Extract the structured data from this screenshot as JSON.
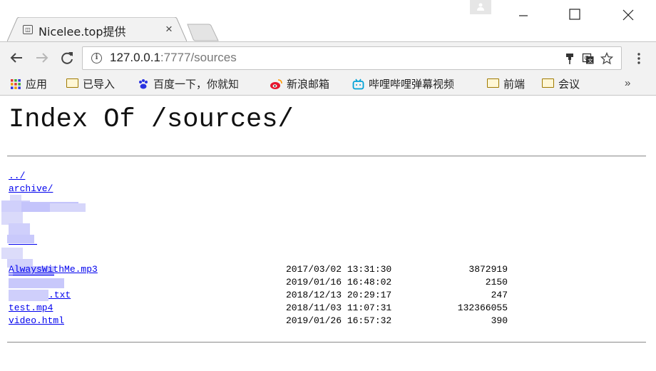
{
  "tab": {
    "title": "Nicelee.top提供",
    "close": "×"
  },
  "omnibox": {
    "host": "127.0.0.1",
    "path": ":7777/sources"
  },
  "bookmarks": [
    {
      "label": "应用",
      "icon": "apps-grid-icon"
    },
    {
      "label": "已导入",
      "icon": "folder-icon"
    },
    {
      "label": "百度一下，你就知",
      "icon": "baidu-paw-icon"
    },
    {
      "label": "新浪邮箱",
      "icon": "weibo-icon"
    },
    {
      "label": "哔哩哔哩弹幕视频",
      "icon": "bilibili-tv-icon"
    },
    {
      "label": "前端",
      "icon": "folder-icon"
    },
    {
      "label": "会议",
      "icon": "folder-icon"
    }
  ],
  "bookmarks_more": "»",
  "page": {
    "heading": "Index Of /sources/",
    "entries": [
      {
        "name": "../",
        "date": "",
        "size": ""
      },
      {
        "name": "archive/",
        "date": "",
        "size": ""
      },
      {
        "name": "AlwaysWithMe.mp3",
        "date": "2017/03/02  13:31:30",
        "size": "3872919"
      },
      {
        "name": "",
        "date": "2019/01/16  16:48:02",
        "size": "2150"
      },
      {
        "name": ".txt",
        "date": "2018/12/13  20:29:17",
        "size": "247"
      },
      {
        "name": "test.mp4",
        "date": "2018/11/03  11:07:31",
        "size": "132366055"
      },
      {
        "name": "video.html",
        "date": "2019/01/26  16:57:32",
        "size": "390"
      }
    ]
  }
}
